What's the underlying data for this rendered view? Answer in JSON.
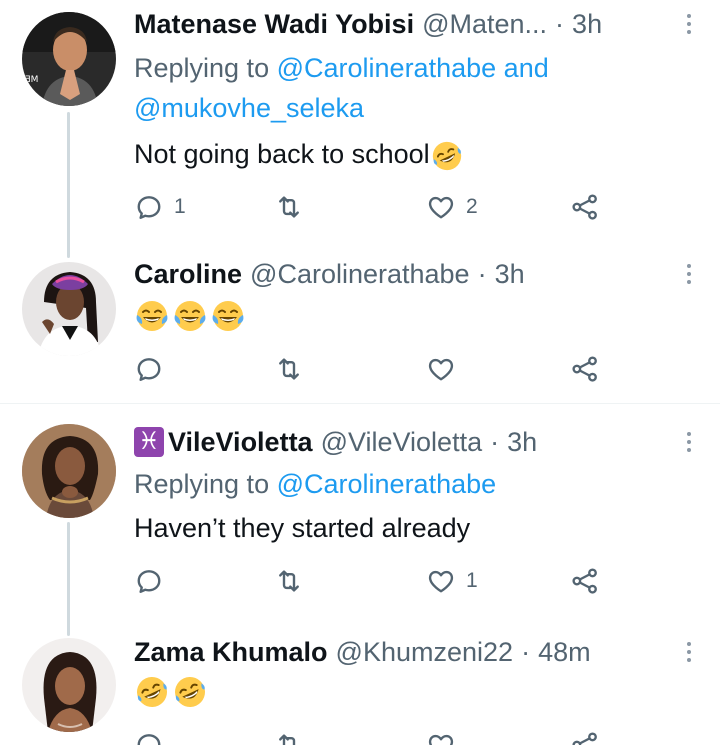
{
  "tweets": [
    {
      "name": "Matenase Wadi Yobisi",
      "handle": "@Maten...",
      "dot": "·",
      "time": "3h",
      "reply_prefix": "Replying to",
      "reply_mention_1": "@Carolinerathabe",
      "reply_and": "and",
      "reply_mention_2": "@mukovhe_seleka",
      "text": "Not going back to school",
      "emojis": [
        "rofl-emoji"
      ],
      "reply_count": "1",
      "retweet_count": "",
      "like_count": "2"
    },
    {
      "name": "Caroline",
      "handle": "@Carolinerathabe",
      "dot": "·",
      "time": "3h",
      "text": "",
      "emojis": [
        "tears-of-joy-emoji",
        "tears-of-joy-emoji",
        "tears-of-joy-emoji"
      ],
      "reply_count": "",
      "retweet_count": "",
      "like_count": ""
    },
    {
      "name_prefix_symbol": "♓",
      "name": "VileVioletta",
      "handle": "@VileVioletta",
      "dot": "·",
      "time": "3h",
      "reply_prefix": "Replying to",
      "reply_mention_1": "@Carolinerathabe",
      "text": "Haven’t they started already",
      "reply_count": "",
      "retweet_count": "",
      "like_count": "1"
    },
    {
      "name": "Zama Khumalo",
      "handle": "@Khumzeni22",
      "dot": "·",
      "time": "48m",
      "text": "",
      "emojis": [
        "rofl-emoji",
        "rofl-emoji"
      ],
      "reply_count": "",
      "retweet_count": "",
      "like_count": ""
    }
  ],
  "icons": {
    "reply": "reply-icon",
    "retweet": "retweet-icon",
    "like": "heart-icon",
    "share": "share-icon",
    "more": "more-icon"
  },
  "colors": {
    "mention": "#1d9bf0",
    "secondary_text": "#536471",
    "thread_line": "#cfd9de",
    "pisces_badge": "#8e44ad"
  }
}
